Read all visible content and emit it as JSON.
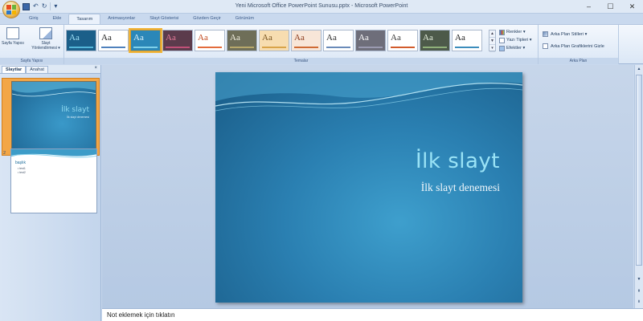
{
  "window": {
    "title": "Yeni Microsoft Office PowerPoint Sunusu.pptx - Microsoft PowerPoint",
    "controls": {
      "minimize": "–",
      "maximize": "☐",
      "close": "✕"
    }
  },
  "qat": {
    "undo": "↶",
    "redo": "↻",
    "more": "▾"
  },
  "tabs": [
    {
      "label": "Giriş"
    },
    {
      "label": "Ekle"
    },
    {
      "label": "Tasarım"
    },
    {
      "label": "Animasyonlar"
    },
    {
      "label": "Slayt Gösterisi"
    },
    {
      "label": "Gözden Geçir"
    },
    {
      "label": "Görünüm"
    }
  ],
  "active_tab": "Tasarım",
  "ribbon": {
    "page_setup_group": {
      "label": "Sayfa Yapısı",
      "page_setup_btn": "Sayfa Yapısı",
      "orientation_btn": "Slayt Yönlendirmesi ▾"
    },
    "themes_group": {
      "label": "Temalar",
      "themes": [
        {
          "sample": "Aa",
          "bg": "#1b5f89",
          "fg": "#9ee0f5",
          "bar": "#54b6d8"
        },
        {
          "sample": "Aa",
          "bg": "#ffffff",
          "fg": "#222222",
          "bar": "#4f81bd"
        },
        {
          "sample": "Aa",
          "bg": "#2b87b8",
          "fg": "#ddf3fb",
          "bar": "#7fd0ea"
        },
        {
          "sample": "Aa",
          "bg": "#5b3b4c",
          "fg": "#e87a9a",
          "bar": "#c05078"
        },
        {
          "sample": "Aa",
          "bg": "#ffffff",
          "fg": "#c24a1f",
          "bar": "#e36c3c"
        },
        {
          "sample": "Aa",
          "bg": "#6e6e58",
          "fg": "#f1efe0",
          "bar": "#b7a86b"
        },
        {
          "sample": "Aa",
          "bg": "#f7ddb0",
          "fg": "#7a5520",
          "bar": "#d9a44a"
        },
        {
          "sample": "Aa",
          "bg": "#f8e6d8",
          "fg": "#8c3b1c",
          "bar": "#cf6b34"
        },
        {
          "sample": "Aa",
          "bg": "#ffffff",
          "fg": "#2d2d2d",
          "bar": "#6a8bb9"
        },
        {
          "sample": "Aa",
          "bg": "#6e6e7a",
          "fg": "#ffffff",
          "bar": "#9a9ab0"
        },
        {
          "sample": "Aa",
          "bg": "#ffffff",
          "fg": "#3a3a3a",
          "bar": "#d25b2c"
        },
        {
          "sample": "Aa",
          "bg": "#4d5a4a",
          "fg": "#e6f0de",
          "bar": "#8fb07a"
        },
        {
          "sample": "Aa",
          "bg": "#ffffff",
          "fg": "#202020",
          "bar": "#3c8dbc"
        }
      ],
      "colors_btn": "Renkler ▾",
      "fonts_btn": "Yazı Tipleri ▾",
      "effects_btn": "Efektler ▾"
    },
    "background_group": {
      "label": "Arka Plan",
      "styles_btn": "Arka Plan Stilleri ▾",
      "hide_graphics": "Arka Plan Grafiklerini Gizle"
    }
  },
  "left_panel": {
    "tabs": [
      {
        "label": "Slaytlar"
      },
      {
        "label": "Anahat"
      }
    ],
    "close": "×",
    "slides": [
      {
        "number": "1",
        "title": "İlk slayt",
        "subtitle": "İlk slayt denemesi"
      },
      {
        "number": "2",
        "title": "başlık",
        "bullets": [
          "• test1",
          "• test2"
        ]
      }
    ]
  },
  "slide": {
    "title": "İlk slayt",
    "subtitle": "İlk slayt denemesi"
  },
  "notes": {
    "placeholder": "Not eklemek için tıklatın"
  }
}
